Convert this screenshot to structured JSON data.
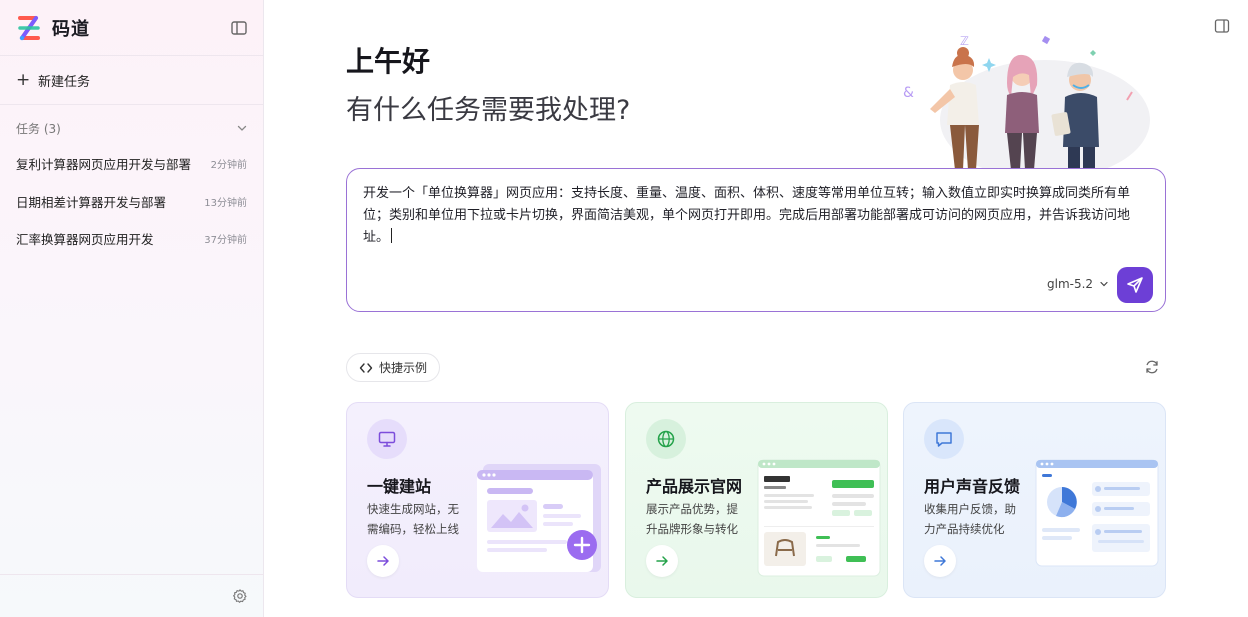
{
  "sidebar": {
    "brand": "码道",
    "new_task": "新建任务",
    "group_label": "任务 (3)",
    "tasks": [
      {
        "title": "复利计算器网页应用开发与部署",
        "time": "2分钟前"
      },
      {
        "title": "日期相差计算器开发与部署",
        "time": "13分钟前"
      },
      {
        "title": "汇率换算器网页应用开发",
        "time": "37分钟前"
      }
    ]
  },
  "main": {
    "greeting": "上午好",
    "subtitle": "有什么任务需要我处理?",
    "prompt": {
      "value": "开发一个「单位换算器」网页应用：支持长度、重量、温度、面积、体积、速度等常用单位互转；输入数值立即实时换算成同类所有单位；类别和单位用下拉或卡片切换，界面简洁美观，单个网页打开即用。完成后用部署功能部署成可访问的网页应用，并告诉我访问地址。",
      "model": "glm-5.2"
    },
    "quick_label": "快捷示例",
    "cards": [
      {
        "title": "一键建站",
        "desc": "快速生成网站，无需编码，轻松上线"
      },
      {
        "title": "产品展示官网",
        "desc": "展示产品优势，提升品牌形象与转化"
      },
      {
        "title": "用户声音反馈",
        "desc": "收集用户反馈，助力产品持续优化"
      }
    ]
  },
  "colors": {
    "accent": "#6d3fd6",
    "prompt_border": "#9a72d6",
    "card_purple": "#f4f0fd",
    "card_green": "#eefaf0",
    "card_blue": "#eef4fd"
  },
  "icons": {
    "brand": "brand-logo-icon",
    "collapse": "sidebar-collapse-icon",
    "plus": "plus-icon",
    "chevron": "chevron-down-icon",
    "settings": "gear-icon",
    "panel": "panel-toggle-icon",
    "send": "send-icon",
    "code": "code-icon",
    "refresh": "refresh-icon",
    "monitor": "monitor-icon",
    "globe": "globe-icon",
    "chat": "chat-bubble-icon",
    "arrow": "arrow-right-icon"
  }
}
